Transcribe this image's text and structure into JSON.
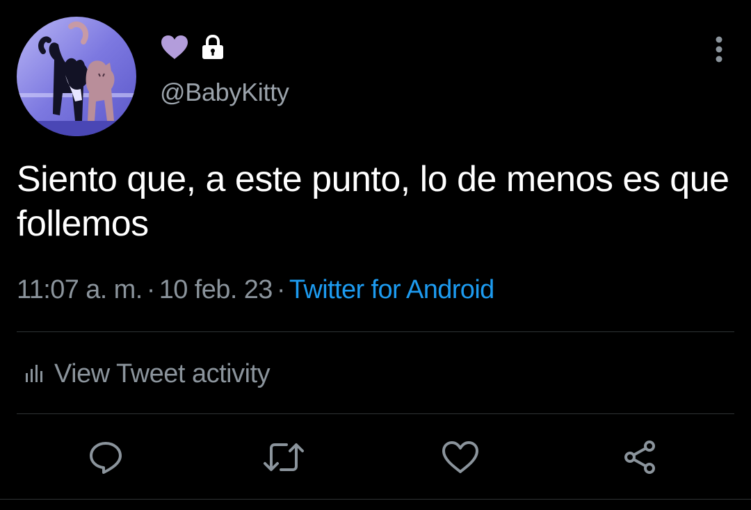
{
  "tweet": {
    "avatar_icon": "cat-photo-avatar",
    "name_emojis": [
      "purple-heart-icon",
      "lock-icon"
    ],
    "handle": "@BabyKitty",
    "text": "Siento que, a este punto, lo de menos es que follemos",
    "time": "11:07 a. m.",
    "date": "10 feb. 23",
    "separator": "·",
    "source": "Twitter for Android"
  },
  "activity": {
    "label": "View Tweet activity",
    "icon": "bar-chart-icon"
  },
  "actions": [
    {
      "name": "reply",
      "icon": "reply-icon"
    },
    {
      "name": "retweet",
      "icon": "retweet-icon"
    },
    {
      "name": "like",
      "icon": "heart-icon"
    },
    {
      "name": "share",
      "icon": "share-icon"
    }
  ],
  "colors": {
    "background": "#000000",
    "text": "#ffffff",
    "secondary_text": "#8b949c",
    "accent": "#1d9bf0",
    "divider": "#2f3336",
    "heart_emoji": "#b39ddb"
  }
}
